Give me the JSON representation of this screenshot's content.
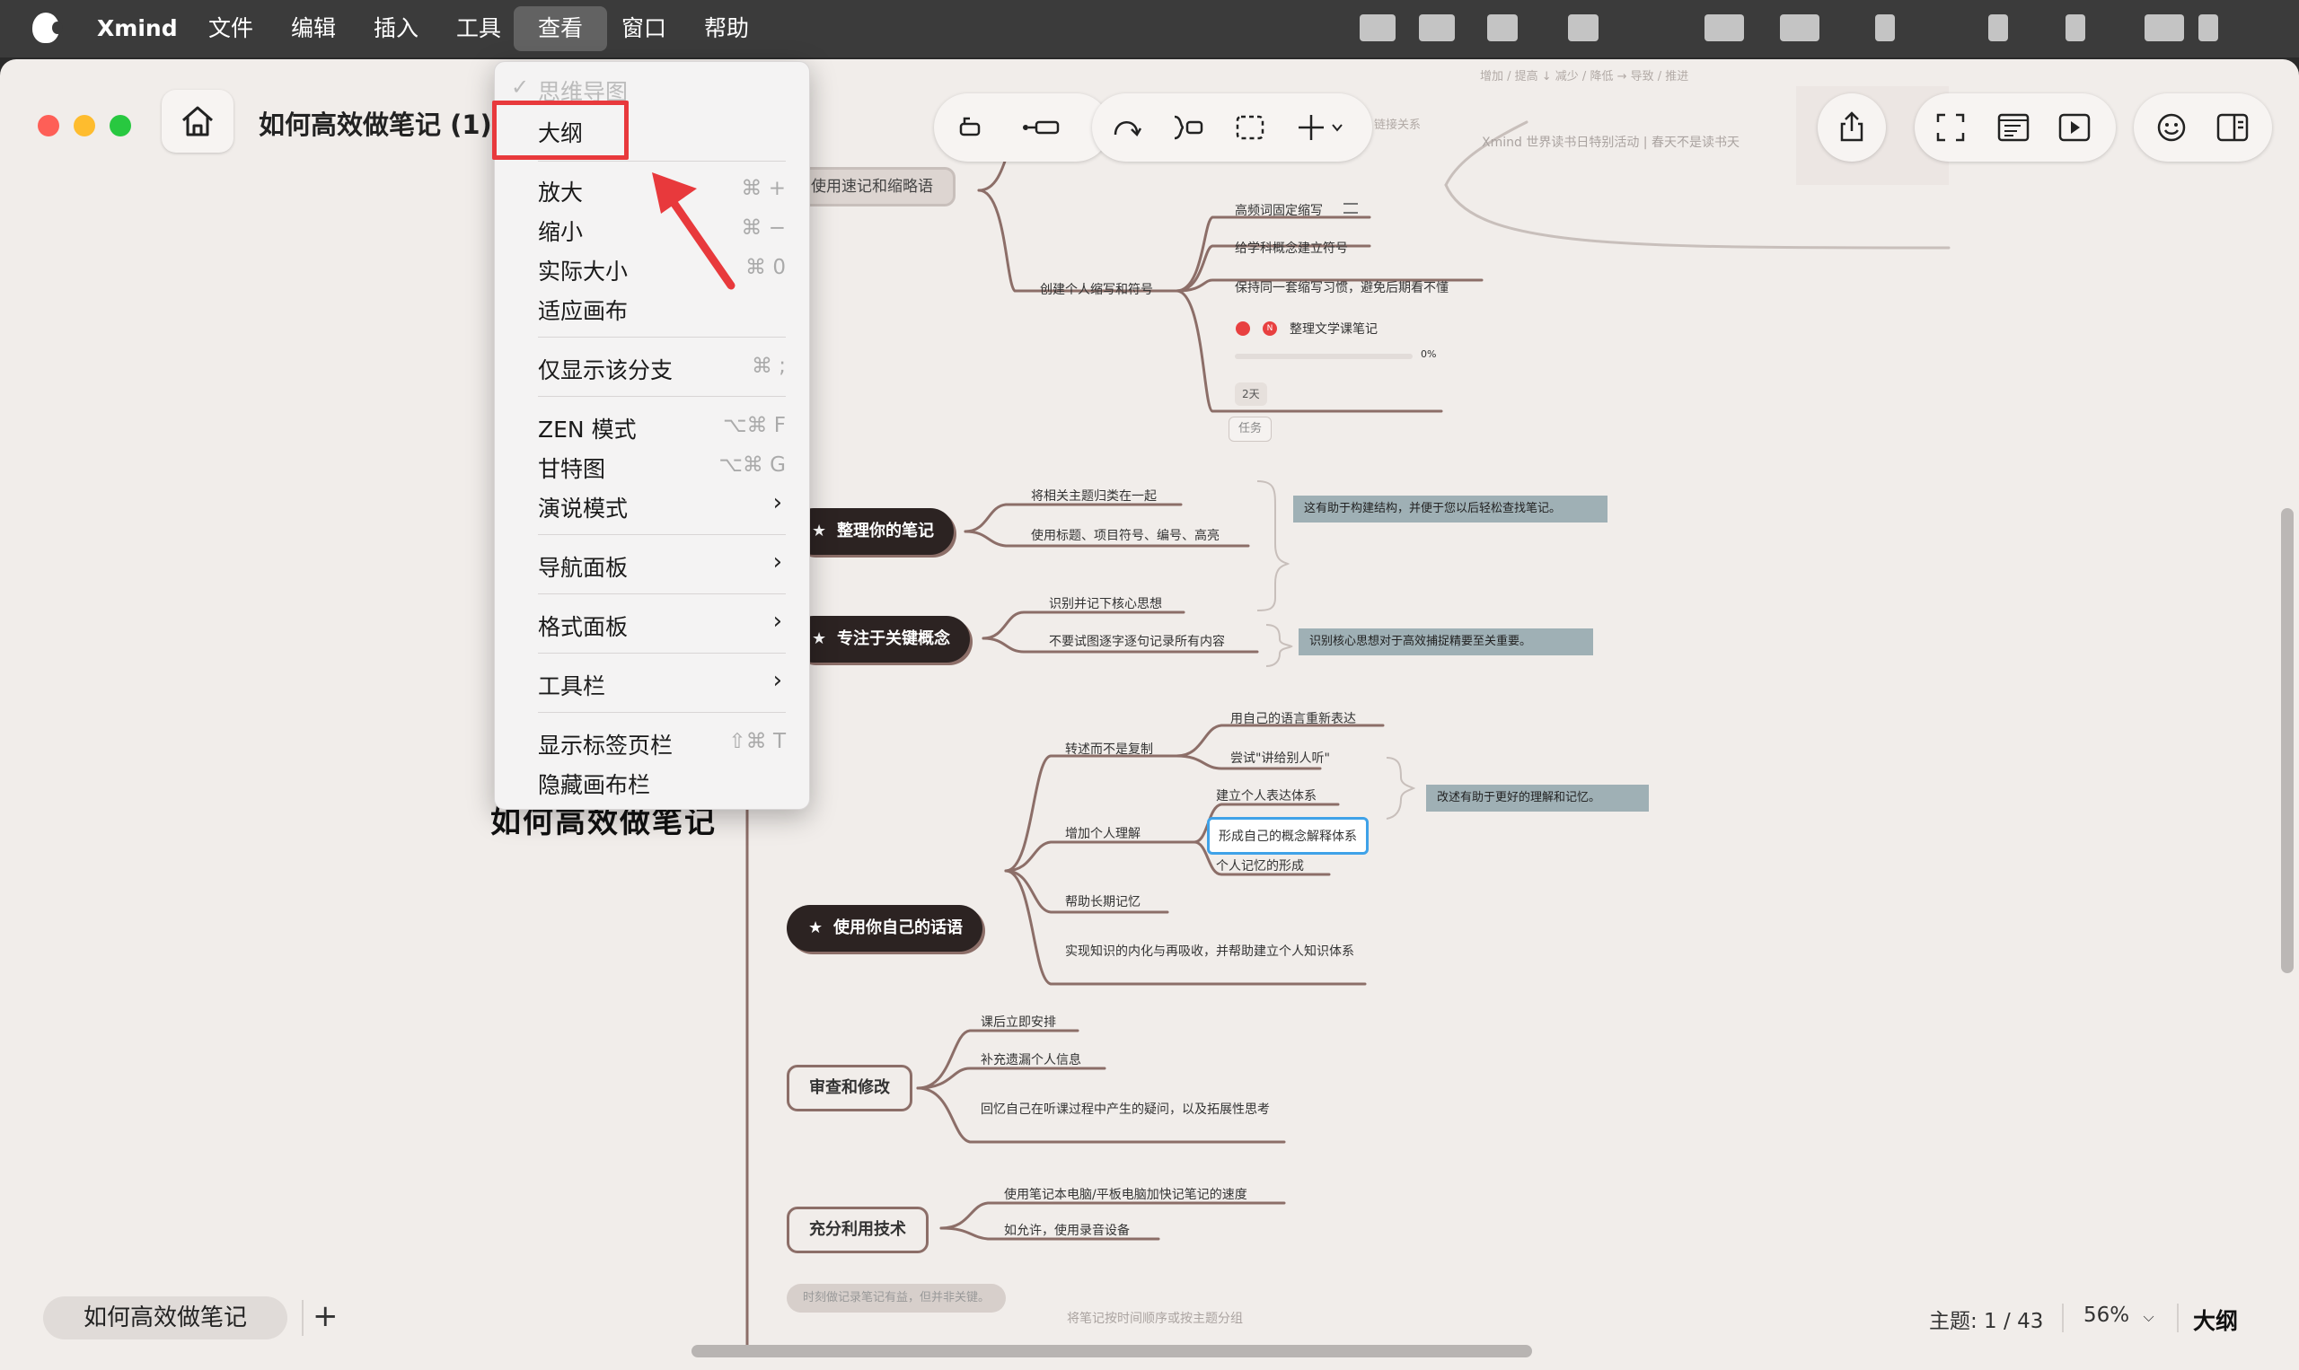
{
  "menubar": {
    "app_name": "Xmind",
    "items": [
      "文件",
      "编辑",
      "插入",
      "工具",
      "查看",
      "窗口",
      "帮助"
    ],
    "active_item": "查看"
  },
  "window": {
    "title": "如何高效做笔记 (1)"
  },
  "view_menu": {
    "checked_item": "思维导图",
    "items": [
      {
        "label": "大纲",
        "shortcut": "",
        "submenu": false,
        "highlighted": true
      },
      {
        "label": "放大",
        "shortcut": "⌘ +",
        "submenu": false
      },
      {
        "label": "缩小",
        "shortcut": "⌘ −",
        "submenu": false
      },
      {
        "label": "实际大小",
        "shortcut": "⌘ 0",
        "submenu": false
      },
      {
        "label": "适应画布",
        "shortcut": "",
        "submenu": false
      },
      {
        "label": "仅显示该分支",
        "shortcut": "⌘ ;",
        "submenu": false
      },
      {
        "label": "ZEN 模式",
        "shortcut": "⌥⌘ F",
        "submenu": false
      },
      {
        "label": "甘特图",
        "shortcut": "⌥⌘ G",
        "submenu": false
      },
      {
        "label": "演说模式",
        "shortcut": "",
        "submenu": true
      },
      {
        "label": "导航面板",
        "shortcut": "",
        "submenu": true
      },
      {
        "label": "格式面板",
        "shortcut": "",
        "submenu": true
      },
      {
        "label": "工具栏",
        "shortcut": "",
        "submenu": true
      },
      {
        "label": "显示标签页栏",
        "shortcut": "⇧⌘ T",
        "submenu": false
      },
      {
        "label": "隐藏画布栏",
        "shortcut": "",
        "submenu": false
      }
    ]
  },
  "mindmap": {
    "root": "如何高效做笔记",
    "top_nodes": {
      "shorthand": "使用速记和缩略语",
      "organize": "整理你的笔记",
      "focus": "专注于关键概念",
      "own_words": "使用你自己的话语",
      "review": "审查和修改",
      "tech": "充分利用技术",
      "faded_bottom": "时刻做记录笔记有益，但并非关键。"
    },
    "shorthand": {
      "sub": "创建个人缩写和符号",
      "leaves": [
        "高频词固定缩写",
        "给学科概念建立符号",
        "保持同一套缩写习惯，避免后期看不懂",
        "整理文学课笔记"
      ],
      "progress_label": "0%",
      "progress": 0,
      "duration": "2天",
      "task_tag": "任务"
    },
    "organize": {
      "leaves": [
        "将相关主题归类在一起",
        "使用标题、项目符号、编号、高亮"
      ],
      "note": "这有助于构建结构，并便于您以后轻松查找笔记。"
    },
    "focus": {
      "leaves": [
        "识别并记下核心思想",
        "不要试图逐字逐句记录所有内容"
      ],
      "note": "识别核心思想对于高效捕捉精要至关重要。"
    },
    "own_words": {
      "sub1": "转述而不是复制",
      "sub1_leaves": [
        "用自己的语言重新表达",
        "尝试\"讲给别人听\""
      ],
      "sub1_note": "改述有助于更好的理解和记忆。",
      "sub2": "增加个人理解",
      "sub2_leaves": [
        "建立个人表达体系",
        "形成自己的概念解释体系",
        "个人记忆的形成"
      ],
      "sub3": "帮助长期记忆",
      "sub4": "实现知识的内化与再吸收，并帮助建立个人知识体系"
    },
    "review": {
      "leaves": [
        "课后立即安排",
        "补充遗漏个人信息",
        "回忆自己在听课过程中产生的疑问，以及拓展性思考"
      ]
    },
    "tech": {
      "leaves": [
        "使用笔记本电脑/平板电脑加快记笔记的速度",
        "如允许，使用录音设备"
      ]
    },
    "top_faded": [
      "增加 / 提高 ↓ 减少 / 降低 → 导致 / 推进",
      "Xmind 世界读书日特别活动 | 春天不是读书天",
      "链接关系"
    ],
    "bottom_faded": "将笔记按时间顺序或按主题分组"
  },
  "statusbar": {
    "tab_label": "如何高效做笔记",
    "topic_count": "主题: 1 / 43",
    "zoom": "56%",
    "outline_button": "大纲"
  },
  "colors": {
    "branch": "#8c6e68",
    "menu_highlight": "#e8393c",
    "selected_border": "#3fa2e8"
  }
}
